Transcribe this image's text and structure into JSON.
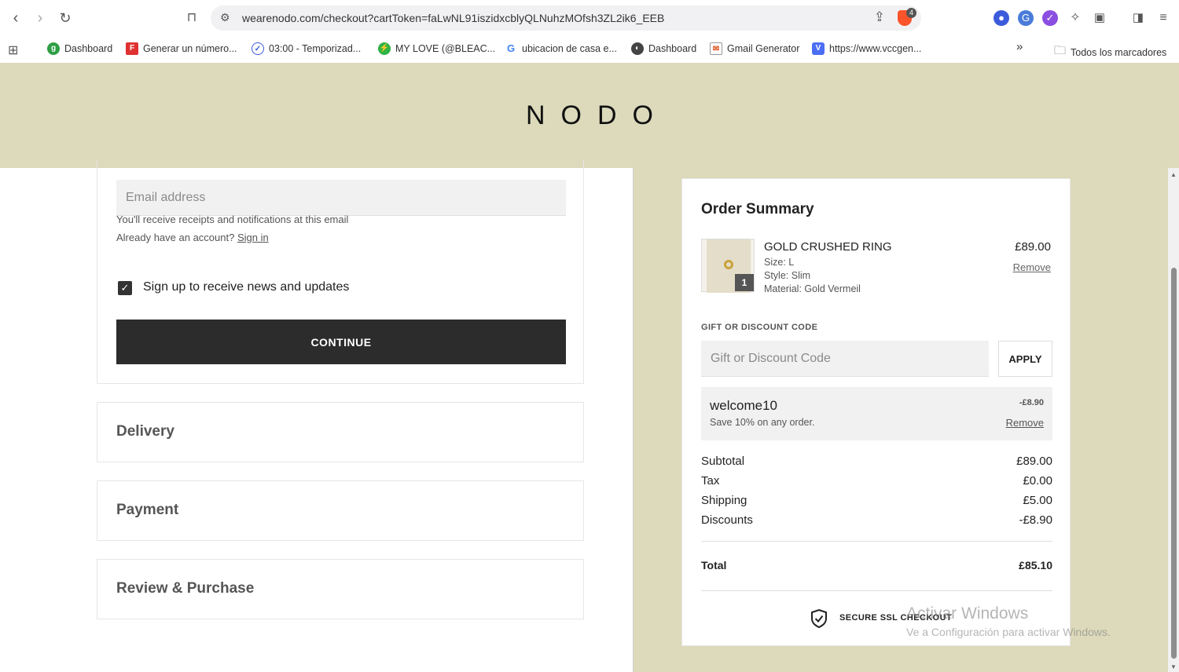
{
  "browser": {
    "url": "wearenodo.com/checkout?cartToken=faLwNL91iszidxcblyQLNuhzMOfsh3ZL2ik6_EEB",
    "shield_count": "4",
    "bookmarks": [
      {
        "label": "Dashboard",
        "icon": "g-circle-icon"
      },
      {
        "label": "Generar un número...",
        "icon": "f-square-icon"
      },
      {
        "label": "03:00 - Temporizad...",
        "icon": "check-circle-icon"
      },
      {
        "label": "MY LOVE (@BLEAC...",
        "icon": "bolt-icon"
      },
      {
        "label": "ubicacion de casa e...",
        "icon": "google-icon"
      },
      {
        "label": "Dashboard",
        "icon": "globe-icon"
      },
      {
        "label": "Gmail Generator",
        "icon": "mail-icon"
      },
      {
        "label": "https://www.vccgen...",
        "icon": "v-icon"
      }
    ],
    "overflow": "»",
    "all_bookmarks": "Todos los marcadores"
  },
  "site": {
    "logo": "NODO"
  },
  "contact": {
    "email_placeholder": "Email address",
    "hint1": "You'll receive receipts and notifications at this email",
    "hint2_prefix": "Already have an account?",
    "sign_in": "Sign in",
    "newsletter_label": "Sign up to receive news and updates",
    "newsletter_checked": true,
    "continue_label": "CONTINUE"
  },
  "sections": [
    "Delivery",
    "Payment",
    "Review & Purchase"
  ],
  "summary": {
    "title": "Order Summary",
    "item": {
      "name": "GOLD CRUSHED RING",
      "size": "Size: L",
      "style": "Style: Slim",
      "material": "Material: Gold Vermeil",
      "price": "£89.00",
      "remove": "Remove",
      "quantity": "1"
    },
    "gift_label": "GIFT OR DISCOUNT CODE",
    "gift_placeholder": "Gift or Discount Code",
    "apply_label": "APPLY",
    "promo": {
      "code": "welcome10",
      "description": "Save 10% on any order.",
      "amount": "-£8.90",
      "remove": "Remove"
    },
    "lines": [
      {
        "label": "Subtotal",
        "value": "£89.00"
      },
      {
        "label": "Tax",
        "value": "£0.00"
      },
      {
        "label": "Shipping",
        "value": "£5.00"
      },
      {
        "label": "Discounts",
        "value": "-£8.90"
      }
    ],
    "total_label": "Total",
    "total_value": "£85.10",
    "ssl_label": "SECURE SSL CHECKOUT"
  },
  "watermark": {
    "line1": "Activar Windows",
    "line2": "Ve a Configuración para activar Windows."
  }
}
